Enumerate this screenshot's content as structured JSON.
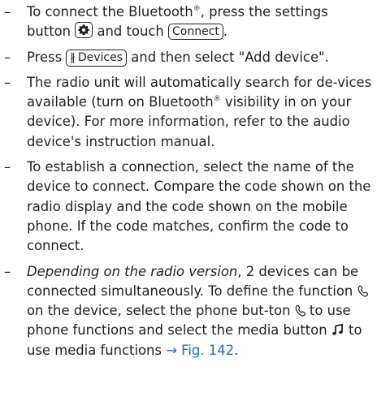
{
  "steps": [
    {
      "text_a": "To connect the Bluetooth",
      "reg": "®",
      "text_b": ", press the settings button ",
      "text_c": " and touch ",
      "key_connect": "Connect",
      "text_d": "."
    },
    {
      "text_a": "Press ",
      "key_devices_icon": "∦",
      "key_devices_label": "Devices",
      "text_b": " and then select \"Add device\"."
    },
    {
      "text_a": "The radio unit will automatically search for de-vices available (turn on Bluetooth",
      "reg": "®",
      "text_b": " visibility in on your device). For more information, refer to the audio device's instruction manual."
    },
    {
      "text_a": "To establish a connection, select the name of the device to connect. Compare the code shown on the radio display and the code shown on the mobile phone. If the code matches, confirm the code to connect."
    },
    {
      "italic": "Depending on the radio version",
      "text_a": ", 2 devices can be connected simultaneously. To define the function ",
      "text_b": " on the device, select the phone but-ton ",
      "text_c": " to use phone functions and select the media button ",
      "text_d": " to use media functions ",
      "xref": "→ Fig. 142",
      "text_e": "."
    }
  ],
  "icons": {
    "settings": "gear-icon",
    "phone": "phone-icon",
    "media": "music-note-icon",
    "bluetooth": "bluetooth-icon"
  },
  "colors": {
    "text": "#1f1f1f",
    "link": "#1b6fc0"
  }
}
